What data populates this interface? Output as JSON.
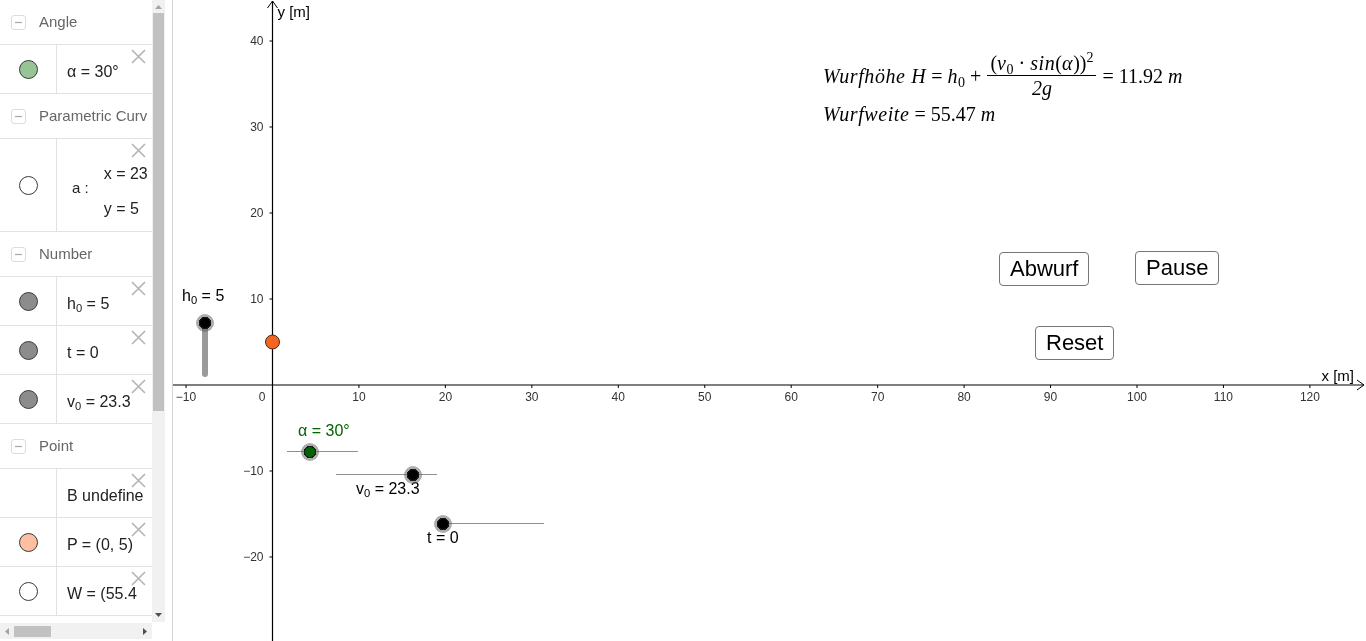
{
  "algebra_view": {
    "groups": [
      {
        "title": "Angle",
        "expanded": true,
        "items": [
          {
            "kind": "value",
            "text": "α = 30°",
            "marble": {
              "shown": true,
              "color": "#96c496"
            }
          }
        ]
      },
      {
        "title": "Parametric Curv",
        "expanded": true,
        "items": [
          {
            "kind": "curve",
            "name": "a :",
            "lines": [
              "x = 23",
              "y = 5"
            ],
            "marble": {
              "shown": false
            }
          }
        ]
      },
      {
        "title": "Number",
        "expanded": true,
        "items": [
          {
            "kind": "value",
            "text": "h$_{0}$ = 5",
            "marble": {
              "shown": true,
              "color": "#8c8c8c"
            }
          },
          {
            "kind": "value",
            "text": "t = 0",
            "marble": {
              "shown": true,
              "color": "#8c8c8c"
            }
          },
          {
            "kind": "value",
            "text": "v$_{0}$ = 23.3",
            "marble": {
              "shown": true,
              "color": "#8c8c8c"
            }
          }
        ]
      },
      {
        "title": "Point",
        "expanded": true,
        "items": [
          {
            "kind": "value",
            "text": "B undefine"
          },
          {
            "kind": "value",
            "text": "P = (0, 5)",
            "marble": {
              "shown": true,
              "color": "#fdbf9f"
            }
          },
          {
            "kind": "value",
            "text": "W = (55.4",
            "marble": {
              "shown": false
            }
          }
        ]
      }
    ]
  },
  "graphics_view": {
    "formula": {
      "lines": [
        {
          "kind": "fraction",
          "lhs": "*Wurfhöhe H* = *h*$_{0}$ +",
          "numerator": "(*v*$_{0}$ · *sin*(*α*))$^{2}$",
          "denominator": "2g",
          "rhs": "= 11.92 *m*"
        },
        {
          "kind": "plain",
          "text": "*Wurfweite* = 55.47 *m*"
        }
      ]
    },
    "buttons": [
      "Abwurf",
      "Pause",
      "Reset"
    ],
    "sliders": [
      {
        "kind": "vertical",
        "label": "h$_{0}$ = 5",
        "level": 1,
        "color": "#000000"
      },
      {
        "kind": "horizontal",
        "label": "α = 30°",
        "level": 0.33,
        "color": "#006400"
      },
      {
        "kind": "horizontal",
        "label": "v$_{0}$ = 23.3",
        "level": 0.76,
        "color": "#000000"
      },
      {
        "kind": "horizontal",
        "label": "t = 0",
        "level": 0,
        "color": "#000000"
      }
    ],
    "origin_label": "0",
    "chart_data": {
      "type": "scatter",
      "xlabel": "x [m]",
      "ylabel": "y [m]",
      "x": [
        0
      ],
      "series": [
        {
          "color": "#f26522",
          "values": [
            5
          ]
        }
      ],
      "xlim": [
        -11.51,
        126.49
      ],
      "ylim": [
        -29.77,
        44.77
      ],
      "xticks": [
        {
          "value": -10,
          "label": "−10"
        },
        10,
        20,
        30,
        40,
        50,
        60,
        70,
        80,
        90,
        100,
        110,
        120
      ],
      "yticks": [
        {
          "value": -20,
          "label": "−20"
        },
        {
          "value": -10,
          "label": "−10"
        },
        10,
        20,
        30,
        40
      ]
    }
  }
}
